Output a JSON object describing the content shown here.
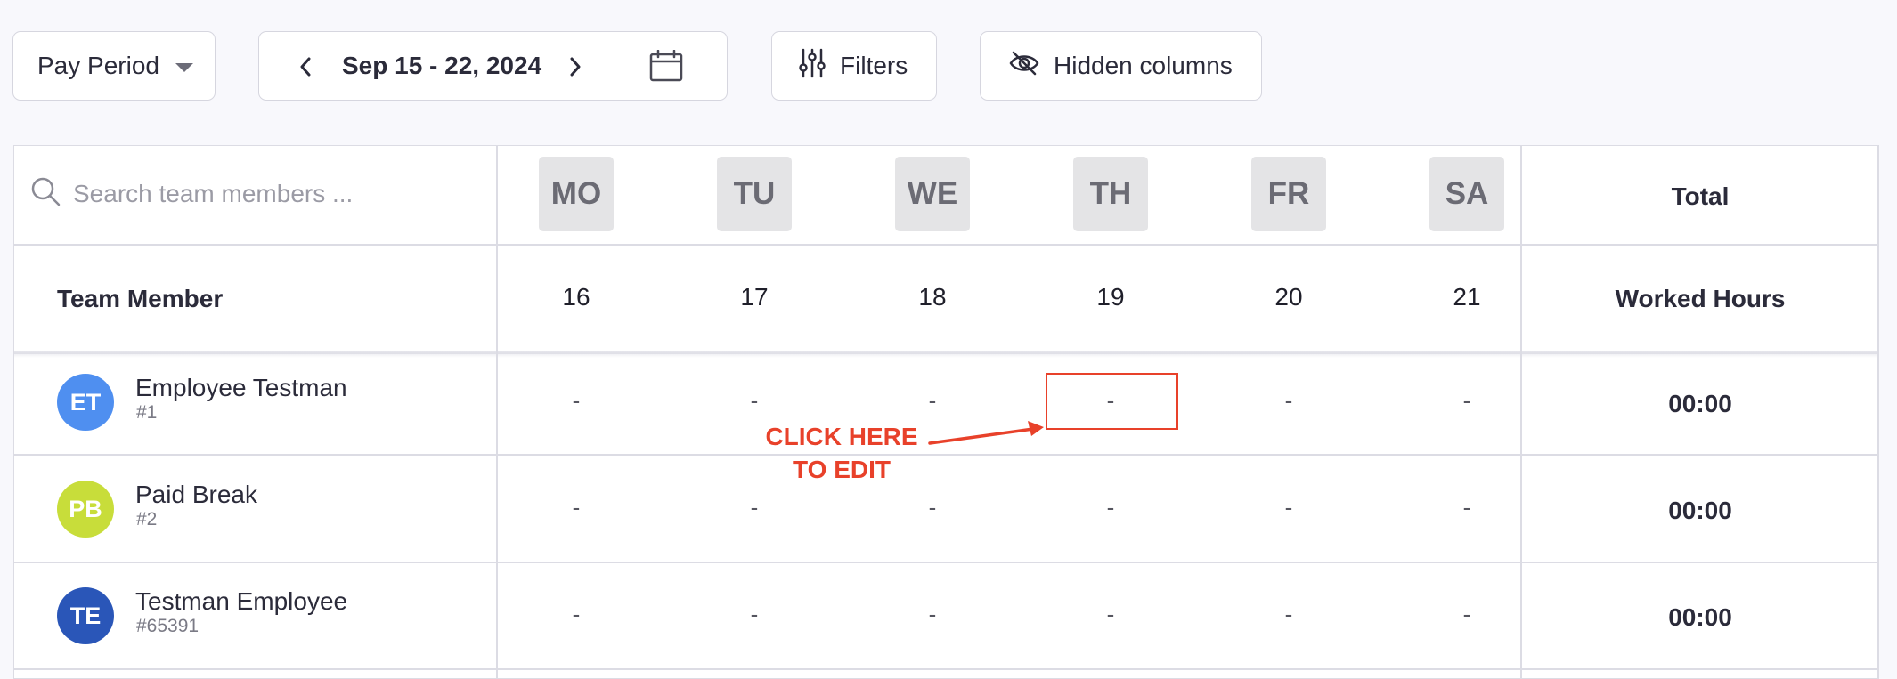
{
  "toolbar": {
    "pay_period_label": "Pay Period",
    "date_range": "Sep 15 - 22, 2024",
    "filters_label": "Filters",
    "hidden_columns_label": "Hidden columns"
  },
  "table": {
    "search_placeholder": "Search team members ...",
    "days": [
      {
        "abbr": "MO",
        "date": "16"
      },
      {
        "abbr": "TU",
        "date": "17"
      },
      {
        "abbr": "WE",
        "date": "18"
      },
      {
        "abbr": "TH",
        "date": "19"
      },
      {
        "abbr": "FR",
        "date": "20"
      },
      {
        "abbr": "SA",
        "date": "21"
      }
    ],
    "total_header": "Total",
    "member_header": "Team Member",
    "worked_hours_header": "Worked Hours",
    "rows": [
      {
        "initials": "ET",
        "name": "Employee Testman",
        "id": "#1",
        "avatar_color": "#4f8ff0",
        "cells": [
          "-",
          "-",
          "-",
          "-",
          "-",
          "-"
        ],
        "total": "00:00"
      },
      {
        "initials": "PB",
        "name": "Paid Break",
        "id": "#2",
        "avatar_color": "#c8dd3a",
        "cells": [
          "-",
          "-",
          "-",
          "-",
          "-",
          "-"
        ],
        "total": "00:00"
      },
      {
        "initials": "TE",
        "name": "Testman Employee",
        "id": "#65391",
        "avatar_color": "#2a56b8",
        "cells": [
          "-",
          "-",
          "-",
          "-",
          "-",
          "-"
        ],
        "total": "00:00"
      }
    ]
  },
  "annotation": {
    "line1": "CLICK HERE",
    "line2": "TO EDIT",
    "color": "#e8412a"
  },
  "icons": {
    "caret": "caret-down-icon",
    "prev": "chevron-left-icon",
    "next": "chevron-right-icon",
    "calendar": "calendar-icon",
    "filters": "sliders-icon",
    "hidden": "eye-slash-icon",
    "search": "search-icon"
  }
}
